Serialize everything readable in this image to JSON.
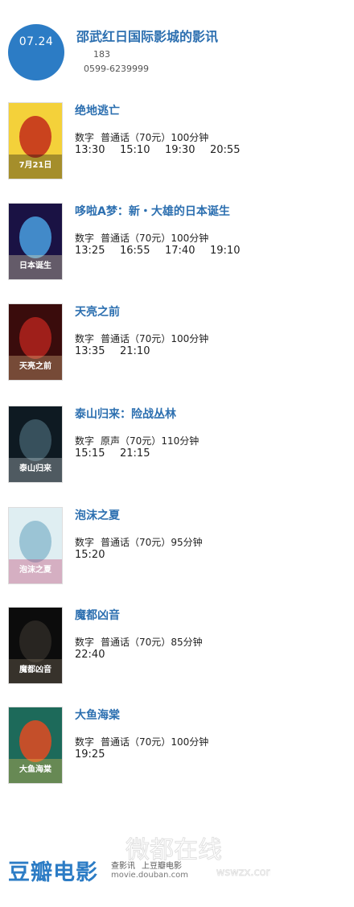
{
  "header": {
    "date": "07.24",
    "cinema_name": "邵武红日国际影城的影讯",
    "address": "183",
    "phone": "0599-6239999"
  },
  "movies": [
    {
      "title": "绝地逃亡",
      "format": "数字",
      "language": "普通话",
      "price": "（70元）",
      "duration": "100分钟",
      "times": [
        "13:30",
        "15:10",
        "19:30",
        "20:55"
      ],
      "poster_colors": [
        "#f4d13a",
        "#c22a1a",
        "#111111"
      ],
      "poster_caption": "7月21日"
    },
    {
      "title": "哆啦A梦：新・大雄的日本诞生",
      "format": "数字",
      "language": "普通话",
      "price": "（70元）",
      "duration": "100分钟",
      "times": [
        "13:25",
        "16:55",
        "17:40",
        "19:10"
      ],
      "poster_colors": [
        "#1a1244",
        "#4aa0e0",
        "#f0e6b0"
      ],
      "poster_caption": "日本诞生"
    },
    {
      "title": "天亮之前",
      "format": "数字",
      "language": "普通话",
      "price": "（70元）",
      "duration": "100分钟",
      "times": [
        "13:35",
        "21:10"
      ],
      "poster_colors": [
        "#3a0c0c",
        "#b2231d",
        "#e8c08a"
      ],
      "poster_caption": "天亮之前"
    },
    {
      "title": "泰山归来：险战丛林",
      "format": "数字",
      "language": "原声",
      "price": "（70元）",
      "duration": "110分钟",
      "times": [
        "15:15",
        "21:15"
      ],
      "poster_colors": [
        "#0e1a22",
        "#3e5a66",
        "#c9d3d6"
      ],
      "poster_caption": "泰山归来"
    },
    {
      "title": "泡沫之夏",
      "format": "数字",
      "language": "普通话",
      "price": "（70元）",
      "duration": "95分钟",
      "times": [
        "15:20"
      ],
      "poster_colors": [
        "#dfeef2",
        "#8fbcd0",
        "#c23a6a"
      ],
      "poster_caption": "泡沫之夏"
    },
    {
      "title": "魔都凶音",
      "format": "数字",
      "language": "普通话",
      "price": "（70元）",
      "duration": "85分钟",
      "times": [
        "22:40"
      ],
      "poster_colors": [
        "#0c0c0c",
        "#2e2a26",
        "#8a7a66"
      ],
      "poster_caption": "魔都凶音"
    },
    {
      "title": "大鱼海棠",
      "format": "数字",
      "language": "普通话",
      "price": "（70元）",
      "duration": "100分钟",
      "times": [
        "19:25"
      ],
      "poster_colors": [
        "#1d6a5a",
        "#e24a22",
        "#f3c24a"
      ],
      "poster_caption": "大鱼海棠"
    }
  ],
  "footer": {
    "logo": "豆瓣电影",
    "link_showtimes": "查影讯",
    "link_go": "上豆瓣电影",
    "url": "movie.douban.com",
    "watermark_text": "微都在线",
    "watermark_sub": "wswzx.com"
  },
  "colors": {
    "accent": "#2c7cc5",
    "title": "#2c6fb0"
  }
}
